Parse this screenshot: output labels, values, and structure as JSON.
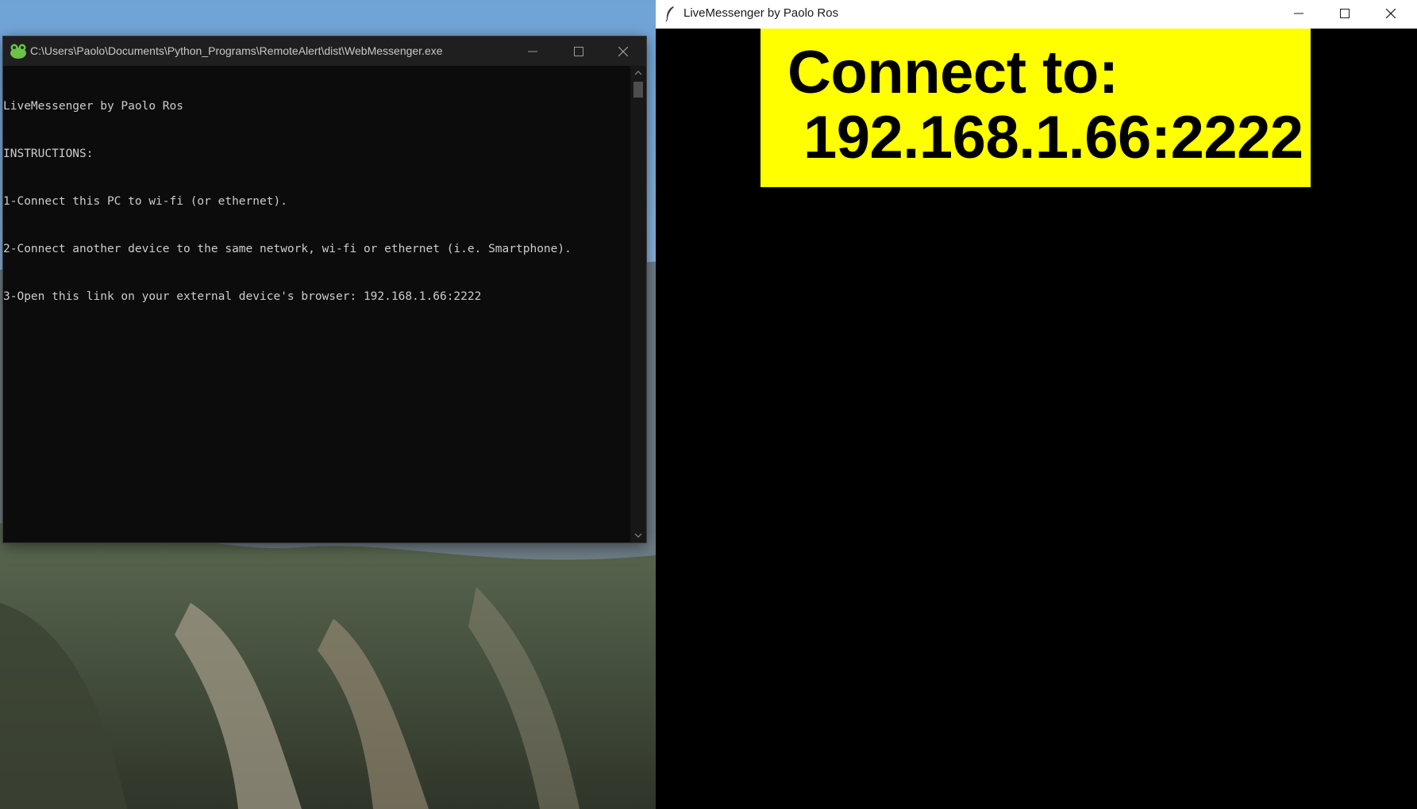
{
  "desktop": {
    "wallpaper": "mountain-cliff-landscape"
  },
  "console_window": {
    "title": "C:\\Users\\Paolo\\Documents\\Python_Programs\\RemoteAlert\\dist\\WebMessenger.exe",
    "icon": "frog-app-icon",
    "lines": [
      "LiveMessenger by Paolo Ros",
      "INSTRUCTIONS:",
      "1-Connect this PC to wi-fi (or ethernet).",
      "2-Connect another device to the same network, wi-fi or ethernet (i.e. Smartphone).",
      "3-Open this link on your external device's browser: 192.168.1.66:2222"
    ],
    "colors": {
      "background": "#0c0c0c",
      "text": "#cccccc",
      "titlebar": "#1f1f1f"
    }
  },
  "messenger_window": {
    "title": "LiveMessenger by Paolo Ros",
    "icon": "feather-icon",
    "banner": {
      "line1": "Connect to:",
      "line2": "192.168.1.66:2222"
    },
    "colors": {
      "banner_background": "#ffff00",
      "banner_text": "#000000",
      "background": "#000000"
    }
  }
}
